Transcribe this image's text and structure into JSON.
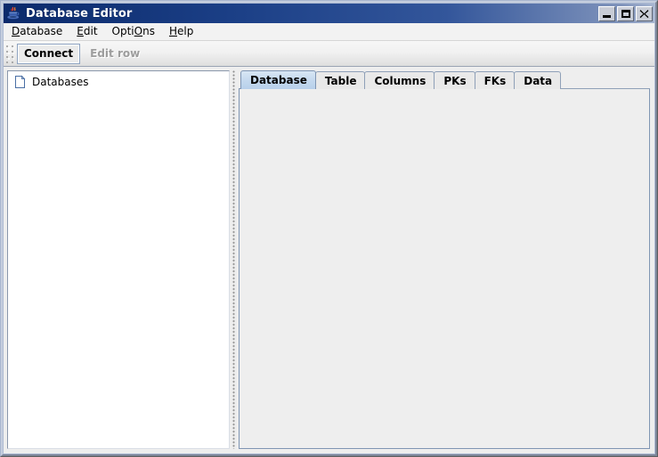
{
  "window": {
    "title": "Database Editor",
    "icon": "java-coffee-cup-icon",
    "controls": {
      "minimize": "Minimize",
      "maximize": "Maximize",
      "close": "Close"
    }
  },
  "menubar": {
    "items": [
      {
        "label": "Database",
        "mnemonic": "D"
      },
      {
        "label": "Edit",
        "mnemonic": "E"
      },
      {
        "label": "Options",
        "mnemonic": "O"
      },
      {
        "label": "Help",
        "mnemonic": "H"
      }
    ]
  },
  "toolbar": {
    "grip": "toolbar-drag-handle",
    "buttons": [
      {
        "label": "Connect",
        "enabled": true,
        "focused": true
      },
      {
        "label": "Edit row",
        "enabled": false,
        "focused": false
      }
    ]
  },
  "tree": {
    "root": {
      "label": "Databases",
      "icon": "document-leaf-icon",
      "expanded": false
    }
  },
  "tabs": {
    "selected_index": 0,
    "items": [
      {
        "label": "Database"
      },
      {
        "label": "Table"
      },
      {
        "label": "Columns"
      },
      {
        "label": "PKs"
      },
      {
        "label": "FKs"
      },
      {
        "label": "Data"
      }
    ]
  },
  "tab_content": {
    "text": ""
  },
  "colors": {
    "titlebar_start": "#0b2a6b",
    "titlebar_end": "#a8b6d1",
    "selected_tab": "#bdd3ec",
    "panel_background": "#eeeeee",
    "tree_background": "#ffffff",
    "border_blue": "#7f95b3"
  }
}
